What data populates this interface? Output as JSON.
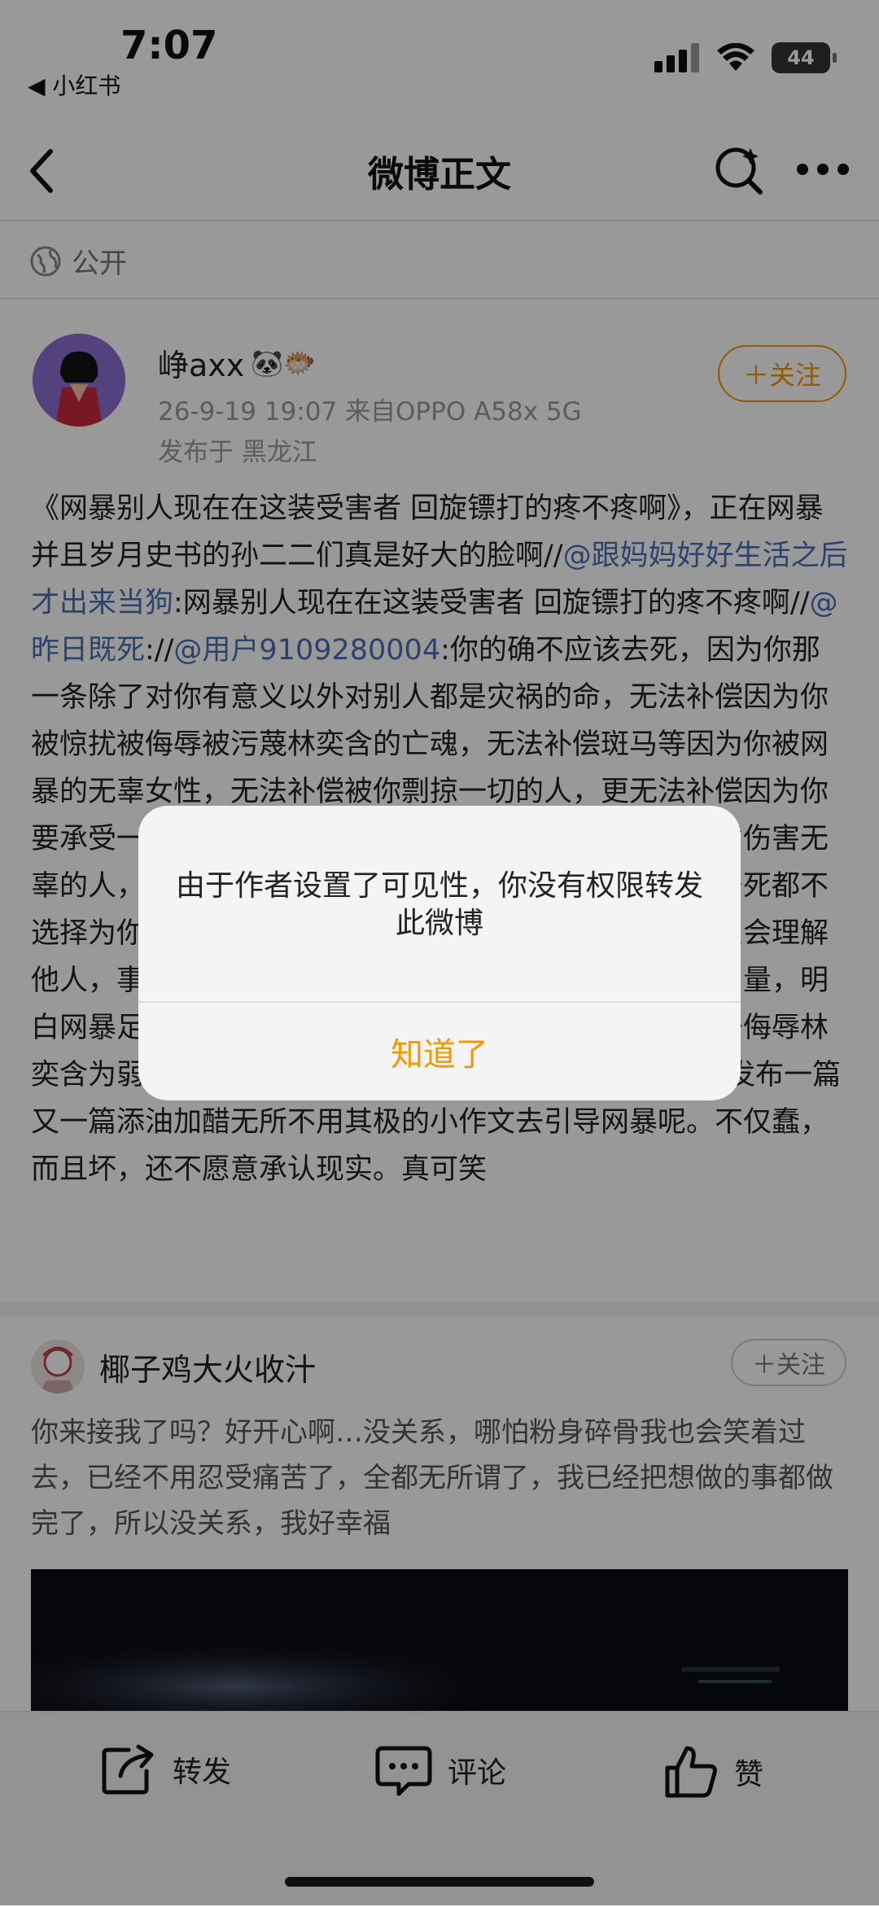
{
  "status_bar": {
    "time": "7:07",
    "back_app": "◀ 小红书",
    "battery": "44"
  },
  "nav": {
    "title": "微博正文"
  },
  "visibility": {
    "label": "公开"
  },
  "post": {
    "author": "峥axx",
    "emoji": "🐼🐡",
    "meta": "26-9-19 19:07  来自OPPO A58x 5G",
    "location": "发布于 黑龙江",
    "follow_label": "＋关注",
    "body_parts": {
      "p1": "《网暴别人现在在这装受害者 回旋镖打的疼不疼啊》，正在网暴并且岁月史书的孙二二们真是好大的脸啊//",
      "m1": "@跟妈妈好好生活之后才出来当狗",
      "p2": ":网暴别人现在在这装受害者 回旋镖打的疼不疼啊//",
      "m2": "@昨日既死",
      "p3": "://",
      "m3": "@用户9109280004",
      "p4": ":你的确不应该去死，因为你那一条除了对你有意义以外对别人都是灾祸的命，无法补偿因为你被惊扰被侮辱被污蔑林奕含的亡魂，无法补偿斑马等因为你被网暴的无辜女性，无法补偿被你剽掠一切的人，更无法补偿因为你要承受一切的你的母亲，自诩正义却总是站在对立面肆意伤害无辜的人，实际上你只是一个连为自己言行负责都做不到宁死都不选择为你自己负责的人，你被网暴后委屈死了，巨婴怎么会理解他人，事情你做了就是做了，开脱，说明你明白语言的力量，明白网暴足以夺走生命的威力，那你又是以什么样的心态去侮辱林奕含为弱虞艳尸，又是以什么样的心态用自己kol的身份发布一篇又一篇添油加醋无所不用其极的小作文去引导网暴呢。不仅蠢，而且坏，还不愿意承认现实。真可笑"
    }
  },
  "card2": {
    "author": "椰子鸡大火收汁",
    "follow_label": "＋关注",
    "body": "你来接我了吗？好开心啊…没关系，哪怕粉身碎骨我也会笑着过去，已经不用忍受痛苦了，全都无所谓了，我已经把想做的事都做完了，所以没关系，我好幸福"
  },
  "bottom_bar": {
    "repost": "转发",
    "comment": "评论",
    "like": "赞"
  },
  "dialog": {
    "message": "由于作者设置了可见性，你没有权限转发此微博",
    "confirm": "知道了"
  },
  "colors": {
    "accent": "#f39800",
    "mention": "#4a6fb5"
  }
}
